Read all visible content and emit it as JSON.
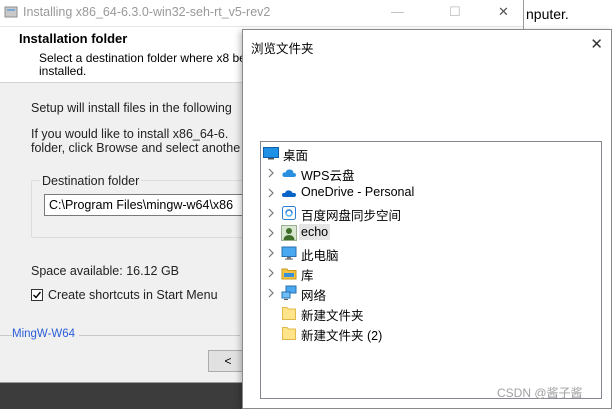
{
  "background_window": {
    "text": "nputer."
  },
  "installer": {
    "title": "Installing x86_64-6.3.0-win32-seh-rt_v5-rev2",
    "header_title": "Installation folder",
    "header_subtitle": "Select a destination folder where x8 be installed.",
    "text_line1": "Setup will install files in the following",
    "text_line2": "If you would like to install x86_64-6.",
    "text_line3": "folder, click Browse and select anothe",
    "destination_label": "Destination folder",
    "destination_value": "C:\\Program Files\\mingw-w64\\x86",
    "space_available": "Space available: 16.12 GB",
    "create_shortcuts_label": "Create shortcuts in Start Menu",
    "create_shortcuts_checked": true,
    "brand": "MingW-W64",
    "back_button": "<"
  },
  "browse_dialog": {
    "title": "浏览文件夹",
    "close_glyph": "✕",
    "tree": [
      {
        "label": "桌面",
        "icon": "desktop-icon",
        "level": 0,
        "chevron": false,
        "selected": false
      },
      {
        "label": "WPS云盘",
        "icon": "cloud-icon",
        "level": 1,
        "chevron": true,
        "selected": false
      },
      {
        "label": "OneDrive - Personal",
        "icon": "onedrive-icon",
        "level": 1,
        "chevron": true,
        "selected": false
      },
      {
        "label": "百度网盘同步空间",
        "icon": "sync-folder-icon",
        "level": 1,
        "chevron": true,
        "selected": false
      },
      {
        "label": "echo",
        "icon": "user-icon",
        "level": 1,
        "chevron": true,
        "selected": true
      },
      {
        "label": "此电脑",
        "icon": "computer-icon",
        "level": 1,
        "chevron": true,
        "selected": false
      },
      {
        "label": "库",
        "icon": "library-icon",
        "level": 1,
        "chevron": true,
        "selected": false
      },
      {
        "label": "网络",
        "icon": "network-icon",
        "level": 1,
        "chevron": true,
        "selected": false
      },
      {
        "label": "新建文件夹",
        "icon": "folder-icon",
        "level": 1,
        "chevron": false,
        "selected": false
      },
      {
        "label": "新建文件夹 (2)",
        "icon": "folder-icon",
        "level": 1,
        "chevron": false,
        "selected": false
      }
    ]
  },
  "watermark": "CSDN @酱子酱"
}
